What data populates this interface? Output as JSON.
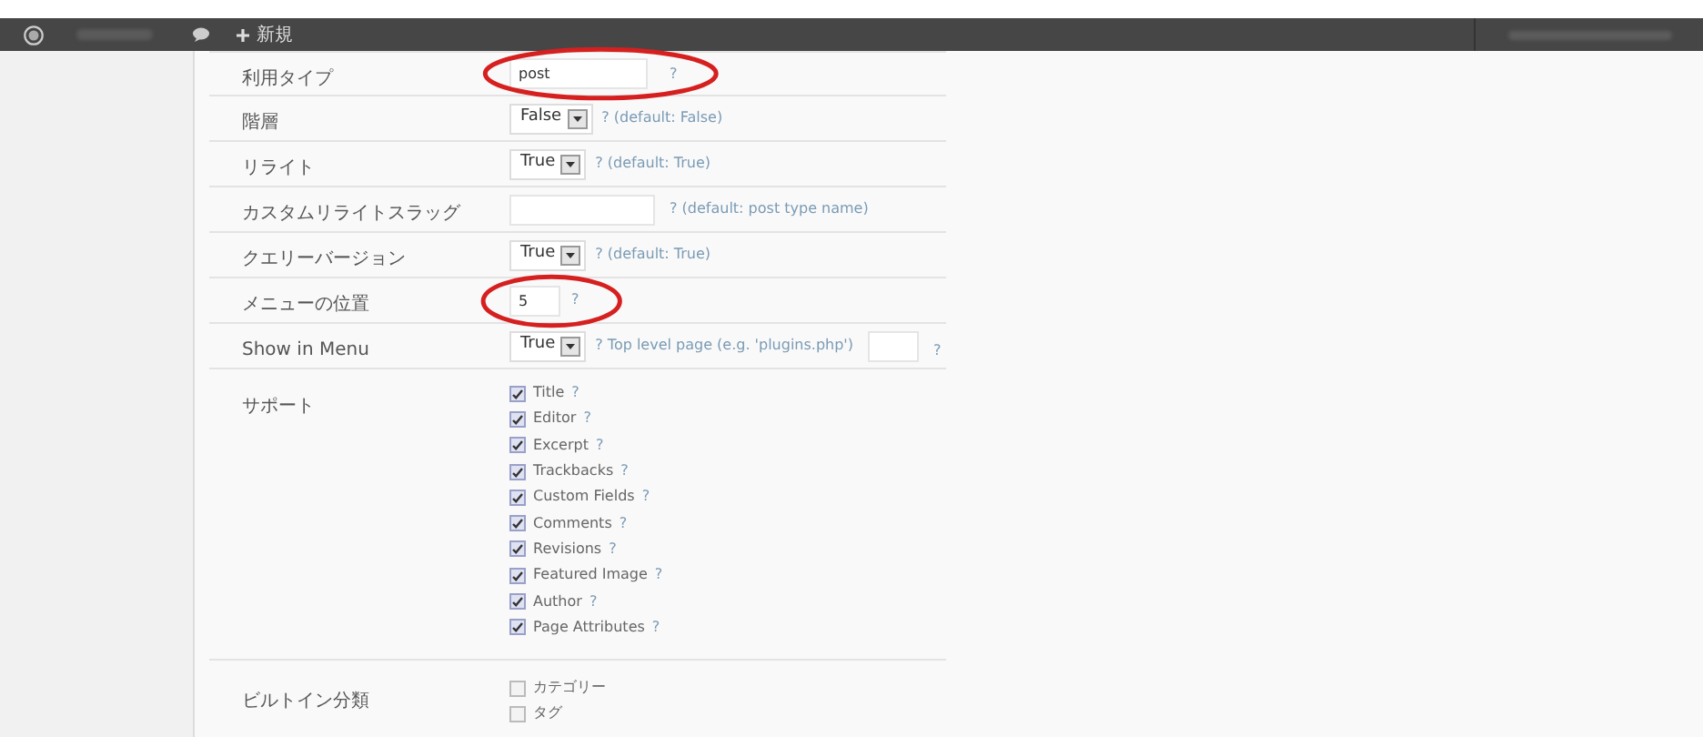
{
  "top_bar": {
    "new_label": "新規"
  },
  "rows": [
    {
      "label": "利用タイプ",
      "kind": "text",
      "value": "post",
      "help": "?",
      "circled": true
    },
    {
      "label": "階層",
      "kind": "select",
      "value": "False",
      "help": "? (default: False)",
      "circled": false
    },
    {
      "label": "リライト",
      "kind": "select",
      "value": "True",
      "help": "? (default: True)",
      "circled": false
    },
    {
      "label": "カスタムリライトスラッグ",
      "kind": "wide_text",
      "help": "? (default: post type name)",
      "circled": false
    },
    {
      "label": "クエリーバージョン",
      "kind": "select",
      "value": "True",
      "help": "? (default: True)",
      "circled": false
    },
    {
      "label": "メニューの位置",
      "kind": "short_text",
      "value": "5",
      "help": "?",
      "circled": true
    },
    {
      "label": "Show in Menu",
      "kind": "select_page",
      "value": "True",
      "help": "? Top level page (e.g. 'plugins.php')",
      "help2": "?",
      "circled": false
    },
    {
      "label": "サポート",
      "kind": "checks",
      "options": [
        {
          "label": "Title",
          "help": "?",
          "checked": true
        },
        {
          "label": "Editor",
          "help": "?",
          "checked": true
        },
        {
          "label": "Excerpt",
          "help": "?",
          "checked": true
        },
        {
          "label": "Trackbacks",
          "help": "?",
          "checked": true
        },
        {
          "label": "Custom Fields",
          "help": "?",
          "checked": true
        },
        {
          "label": "Comments",
          "help": "?",
          "checked": true
        },
        {
          "label": "Revisions",
          "help": "?",
          "checked": true
        },
        {
          "label": "Featured Image",
          "help": "?",
          "checked": true
        },
        {
          "label": "Author",
          "help": "?",
          "checked": true
        },
        {
          "label": "Page Attributes",
          "help": "?",
          "checked": true
        }
      ]
    },
    {
      "label": "ビルトイン分類",
      "kind": "checks",
      "options": [
        {
          "label": "カテゴリー",
          "checked": false
        },
        {
          "label": "タグ",
          "checked": false
        }
      ]
    }
  ]
}
